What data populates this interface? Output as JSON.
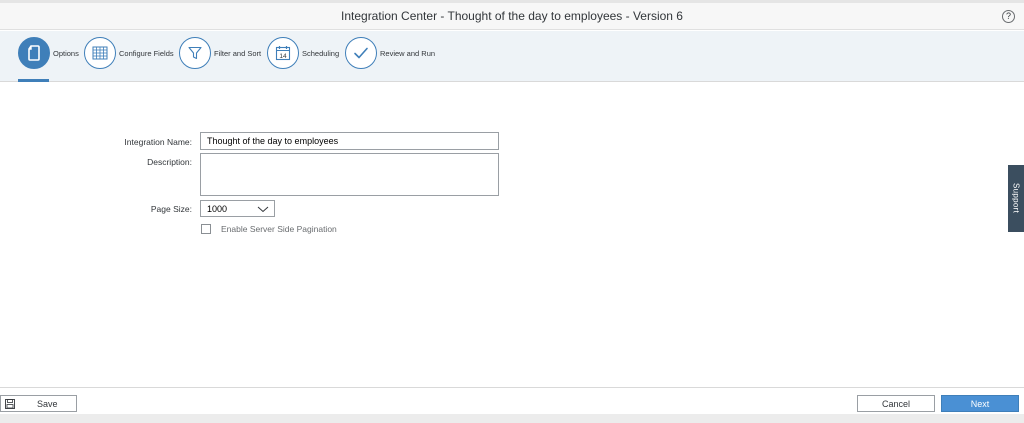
{
  "window": {
    "title": "Integration Center - Thought of the day to employees - Version 6",
    "help_glyph": "?"
  },
  "wizard": {
    "steps": [
      {
        "label": "Options",
        "icon": "document-icon",
        "active": true
      },
      {
        "label": "Configure Fields",
        "icon": "grid-icon",
        "active": false
      },
      {
        "label": "Filter and Sort",
        "icon": "funnel-icon",
        "active": false
      },
      {
        "label": "Scheduling",
        "icon": "calendar-icon",
        "active": false
      },
      {
        "label": "Review and Run",
        "icon": "checkmark-icon",
        "active": false
      }
    ],
    "calendar_day": "14"
  },
  "form": {
    "integration_name_label": "Integration Name:",
    "integration_name_value": "Thought of the day to employees",
    "description_label": "Description:",
    "description_value": "",
    "page_size_label": "Page Size:",
    "page_size_value": "1000",
    "server_pagination_label": "Enable Server Side Pagination",
    "server_pagination_checked": false
  },
  "support_tab": {
    "label": "Support"
  },
  "footer": {
    "save_label": "Save",
    "cancel_label": "Cancel",
    "next_label": "Next"
  },
  "colors": {
    "accent": "#3f7fb9",
    "next_button": "#4a90d4",
    "support_tab": "#3b4e5f",
    "wizard_bg": "#eef3f7"
  }
}
